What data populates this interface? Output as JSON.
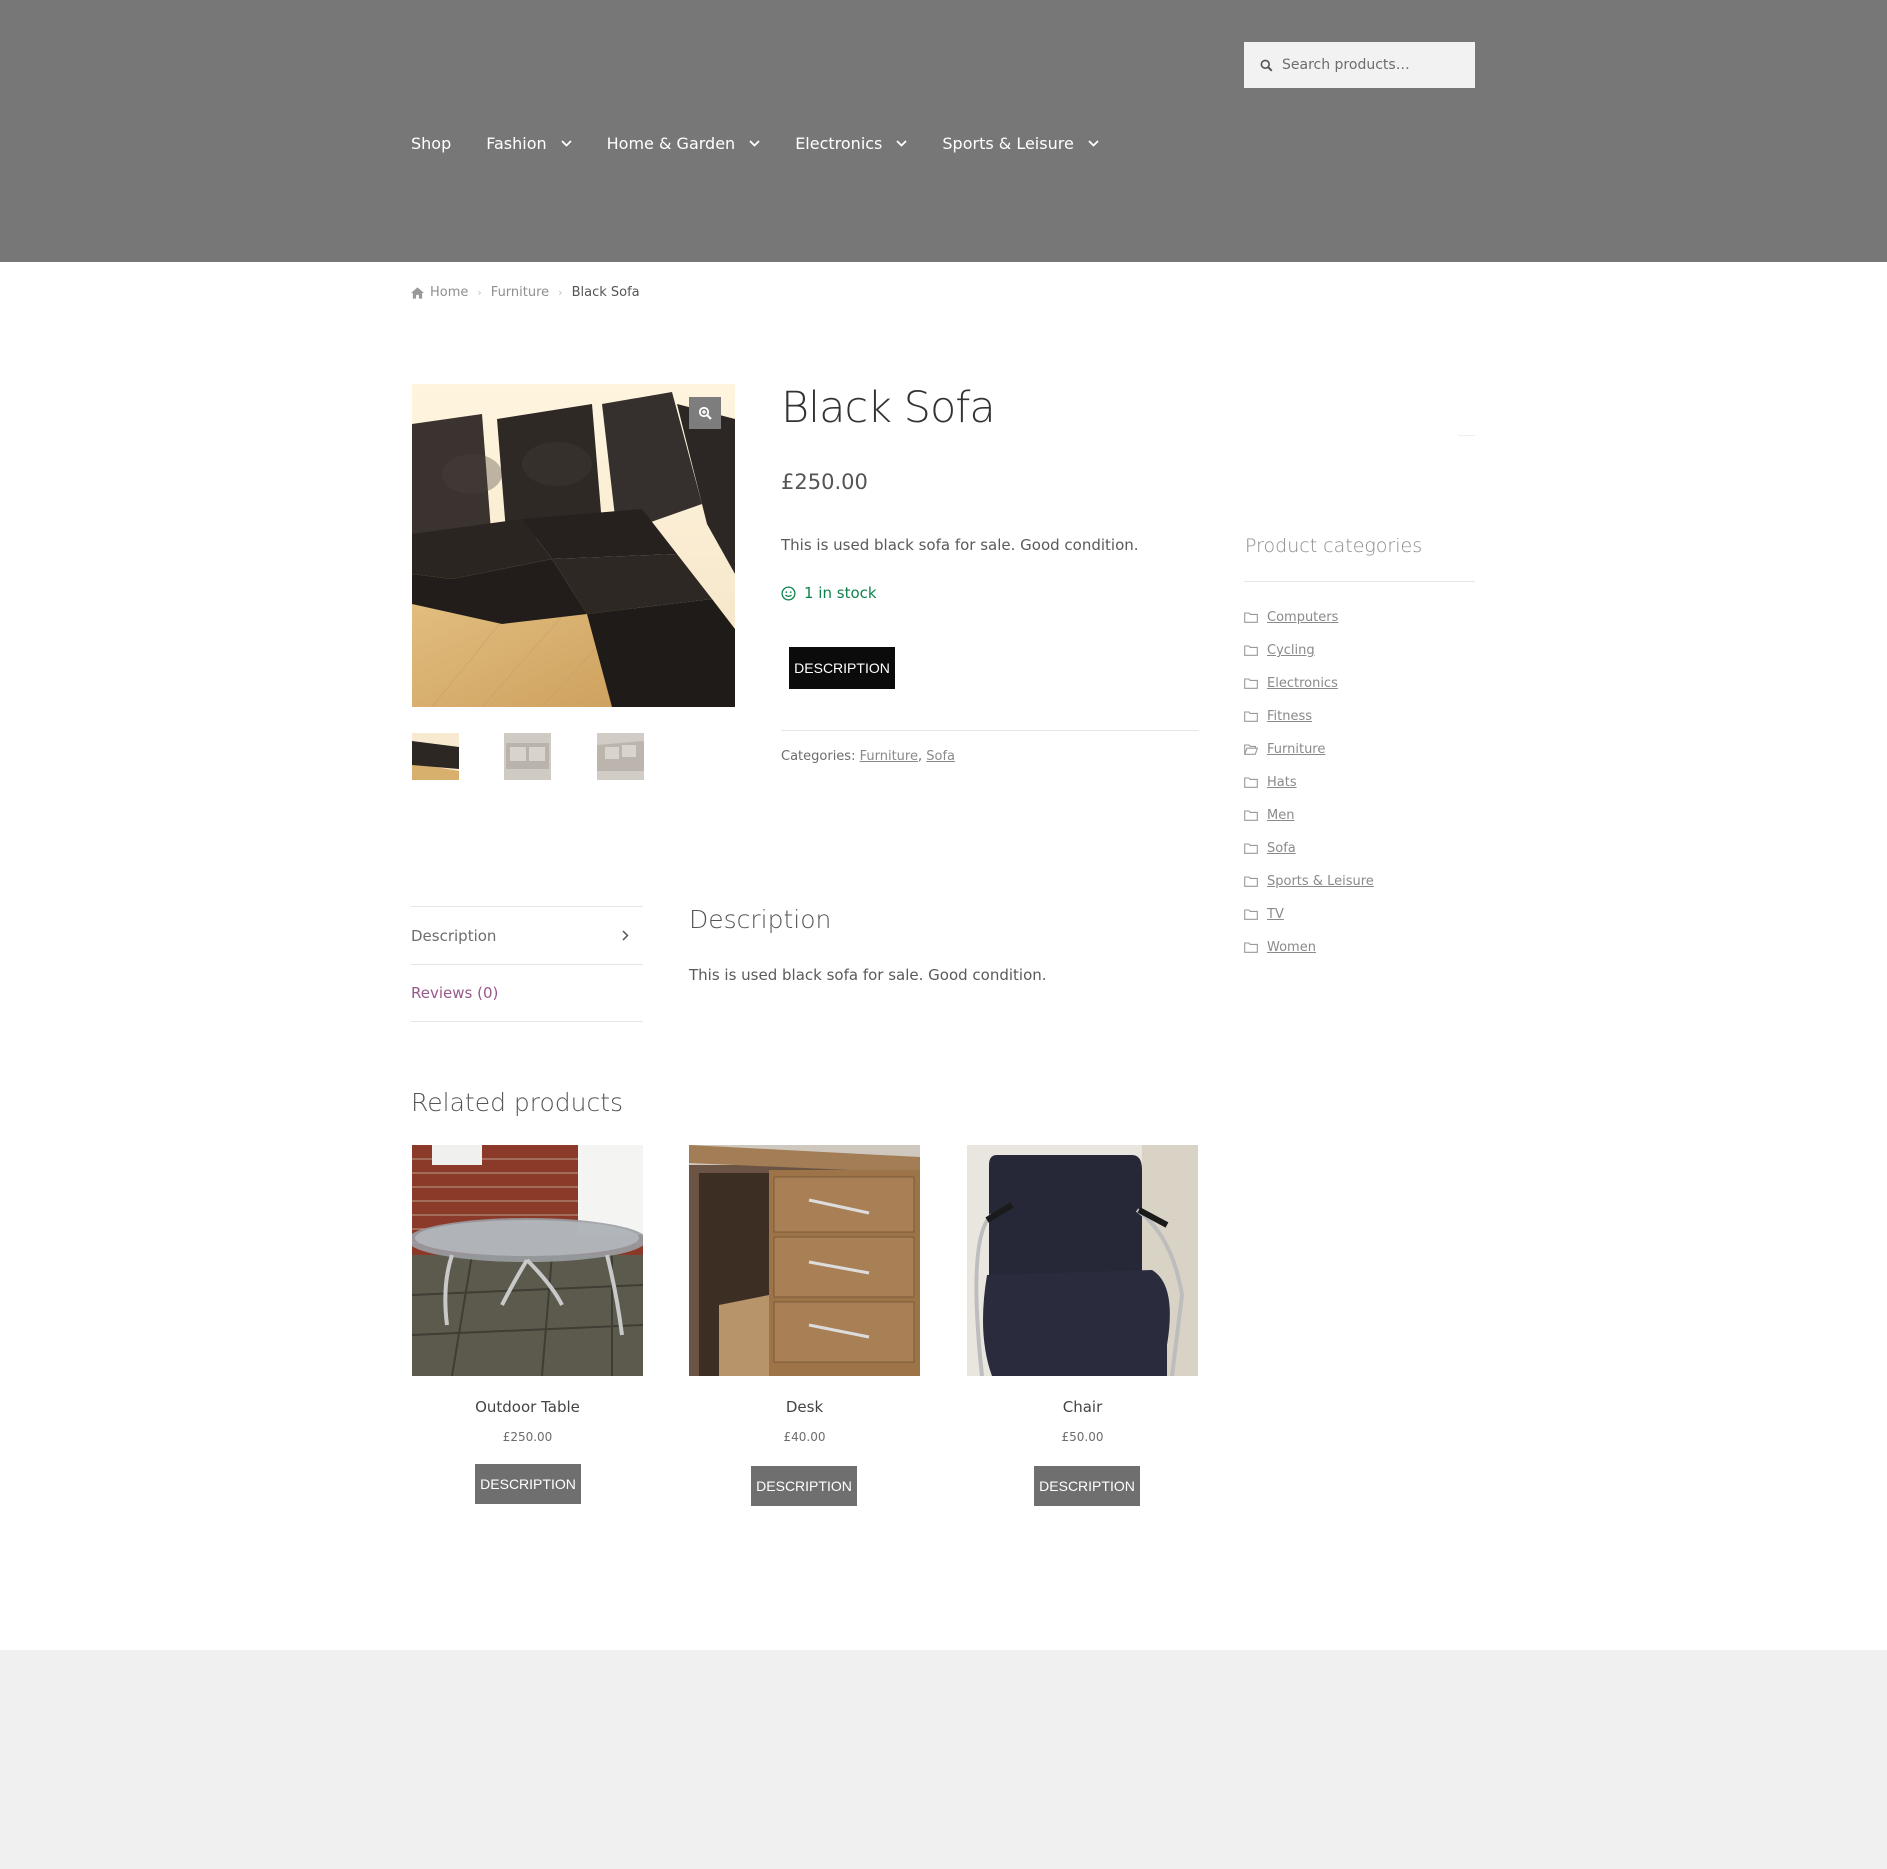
{
  "search": {
    "placeholder": "Search products…"
  },
  "nav": {
    "items": [
      {
        "label": "Shop",
        "dropdown": false
      },
      {
        "label": "Fashion",
        "dropdown": true
      },
      {
        "label": "Home & Garden",
        "dropdown": true
      },
      {
        "label": "Electronics",
        "dropdown": true
      },
      {
        "label": "Sports & Leisure",
        "dropdown": true
      }
    ]
  },
  "breadcrumb": {
    "home": "Home",
    "category": "Furniture",
    "current": "Black Sofa"
  },
  "product": {
    "title": "Black Sofa",
    "price": "£250.00",
    "short_description": "This is used black sofa for sale. Good condition.",
    "stock": "1 in stock",
    "button_label": "DESCRIPTION",
    "categories_label": "Categories:",
    "categories": [
      "Furniture",
      "Sofa"
    ],
    "categories_sep": ","
  },
  "tabs": {
    "items": [
      {
        "label": "Description"
      },
      {
        "label": "Reviews (0)"
      }
    ],
    "panel_title": "Description",
    "panel_text": "This is used black sofa for sale. Good condition."
  },
  "sidebar": {
    "title": "Product categories",
    "categories": [
      "Computers",
      "Cycling",
      "Electronics",
      "Fitness",
      "Furniture",
      "Hats",
      "Men",
      "Sofa",
      "Sports & Leisure",
      "TV",
      "Women"
    ],
    "open_category": "Furniture"
  },
  "related": {
    "title": "Related products",
    "products": [
      {
        "name": "Outdoor Table",
        "price": "£250.00",
        "button": "DESCRIPTION"
      },
      {
        "name": "Desk",
        "price": "£40.00",
        "button": "DESCRIPTION"
      },
      {
        "name": "Chair",
        "price": "£50.00",
        "button": "DESCRIPTION"
      }
    ]
  },
  "colors": {
    "header_bg": "#777777",
    "stock_green": "#0f834d",
    "reviews_purple": "#96588a",
    "footer_bg": "#f0f0f0"
  },
  "icons": {
    "search": "search-icon",
    "chevron": "chevron-down-icon",
    "home": "home-icon",
    "zoom": "zoom-icon",
    "stock": "smiley-icon",
    "folder": "folder-icon",
    "folder_open": "folder-open-icon",
    "tab_arrow": "chevron-right-icon"
  }
}
